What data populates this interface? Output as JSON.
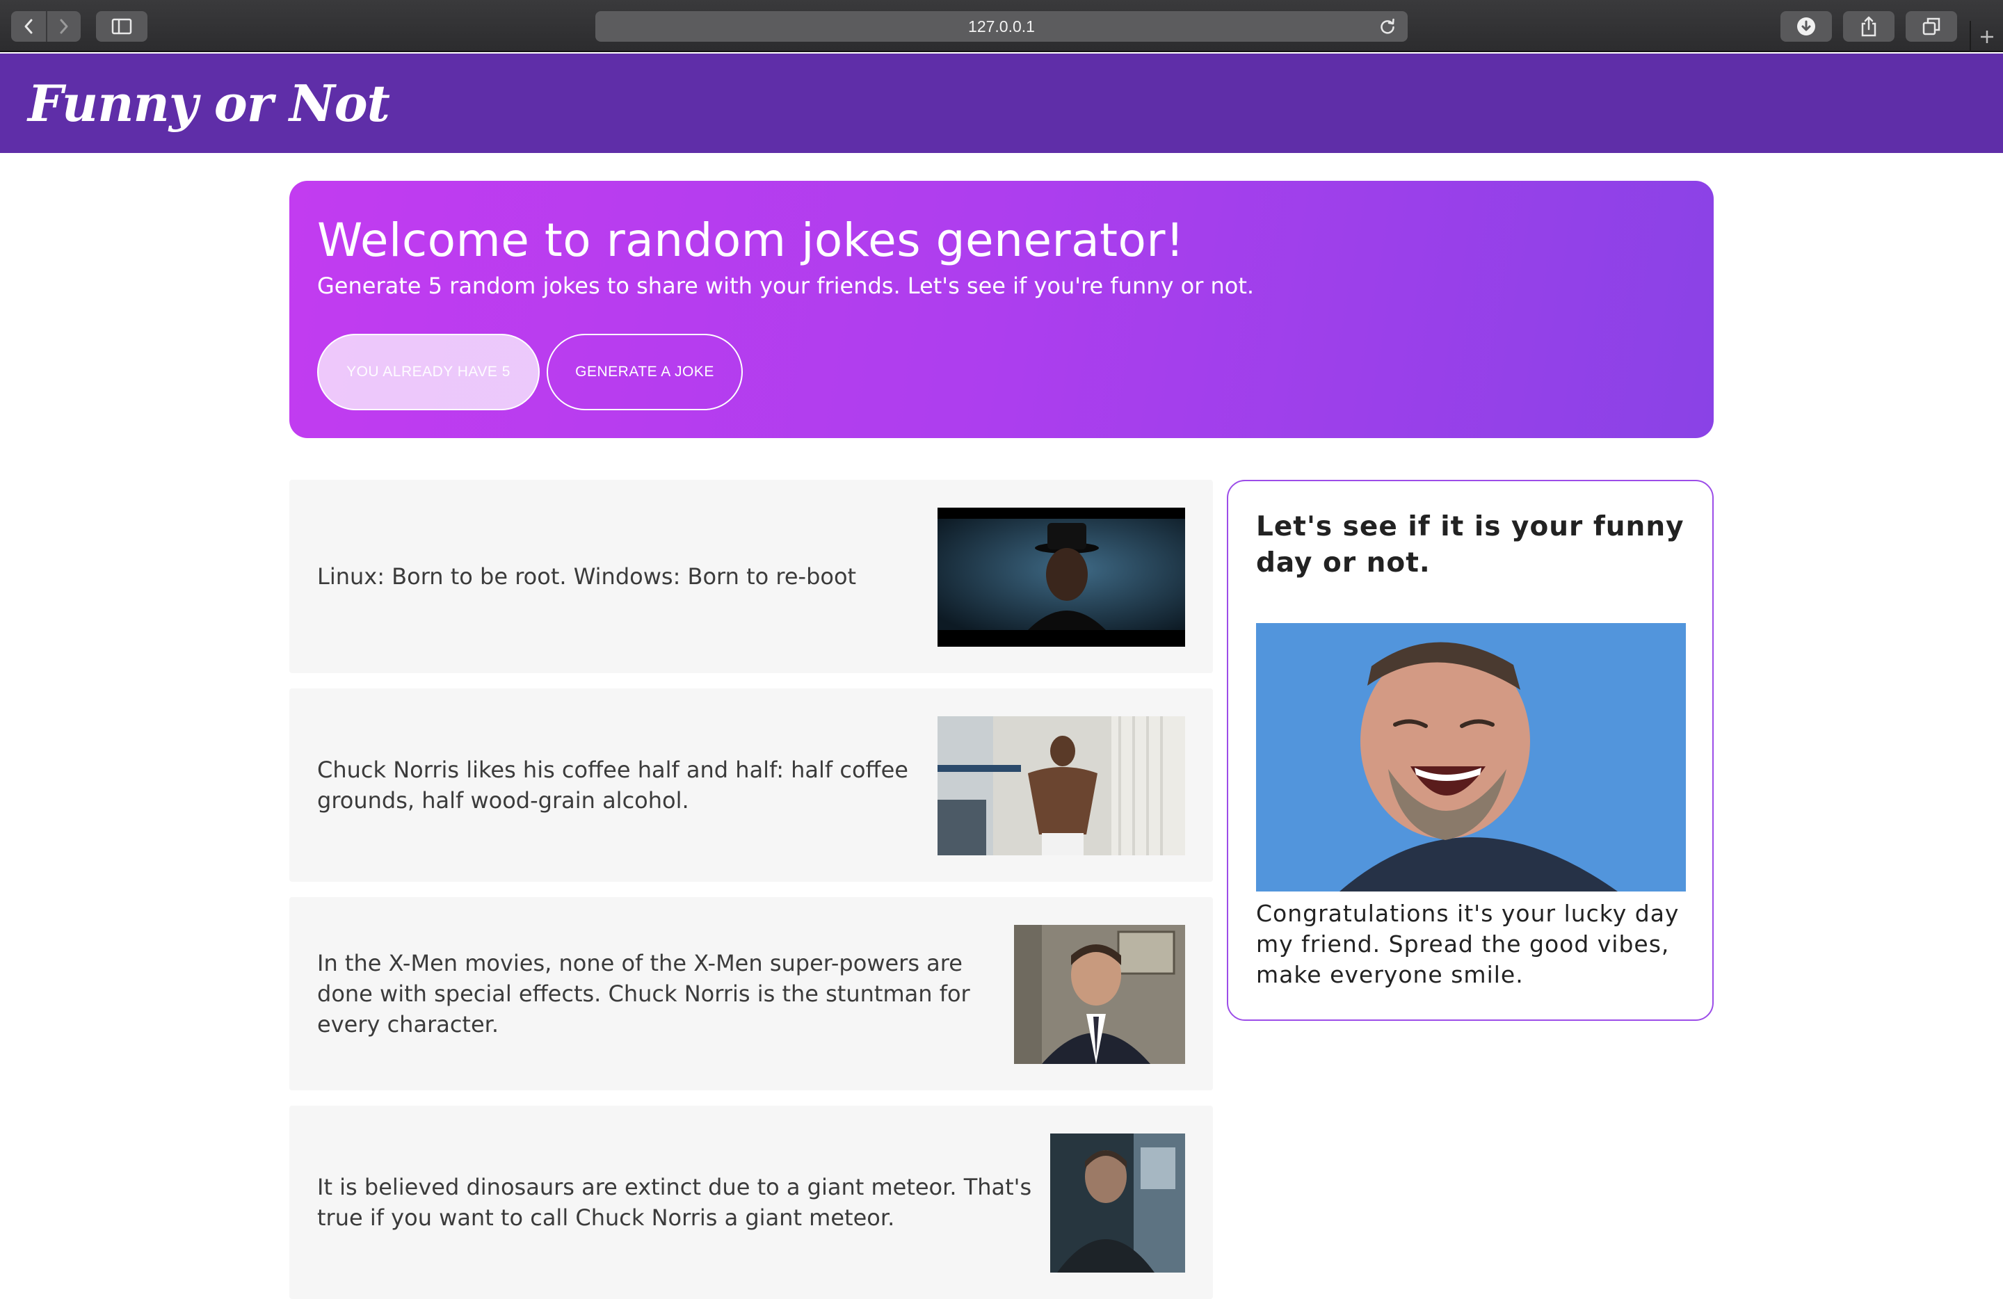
{
  "browser": {
    "url": "127.0.0.1",
    "icons": {
      "back": "chevron-left-icon",
      "forward": "chevron-right-icon",
      "sidebar": "sidebar-icon",
      "reload": "reload-icon",
      "download": "download-icon",
      "share": "share-icon",
      "tabs": "tabs-icon",
      "new_tab": "plus-icon"
    }
  },
  "header": {
    "logo": "Funny or Not",
    "background": "#5f2ea8"
  },
  "hero": {
    "title": "Welcome to random jokes generator!",
    "subtitle": "Generate 5 random jokes to share with your friends. Let's see if you're funny or not.",
    "disabled_button": "YOU ALREADY HAVE 5",
    "generate_button": "GENERATE A JOKE",
    "gradient": [
      "#c23cf0",
      "#8a42e6"
    ]
  },
  "jokes": [
    {
      "text": "Linux: Born to be root. Windows: Born to re-boot",
      "image": "man-in-top-hat-gif"
    },
    {
      "text": "Chuck Norris likes his coffee half and half: half coffee grounds, half wood-grain alcohol.",
      "image": "man-in-shower-gif"
    },
    {
      "text": "In the X-Men movies, none of the X-Men super-powers are done with special effects. Chuck Norris is the stuntman for every character.",
      "image": "man-in-suit-office-gif"
    },
    {
      "text": "It is believed dinosaurs are extinct due to a giant meteor. That's true if you want to call Chuck Norris a giant meteor.",
      "image": "man-in-hallway-gif"
    }
  ],
  "day_card": {
    "title": "Let's see if it is your funny day or not.",
    "image": "man-laughing-gif",
    "message": "Congratulations it's your lucky day my friend. Spread the good vibes, make everyone smile.",
    "border_color": "#9c4de8"
  }
}
